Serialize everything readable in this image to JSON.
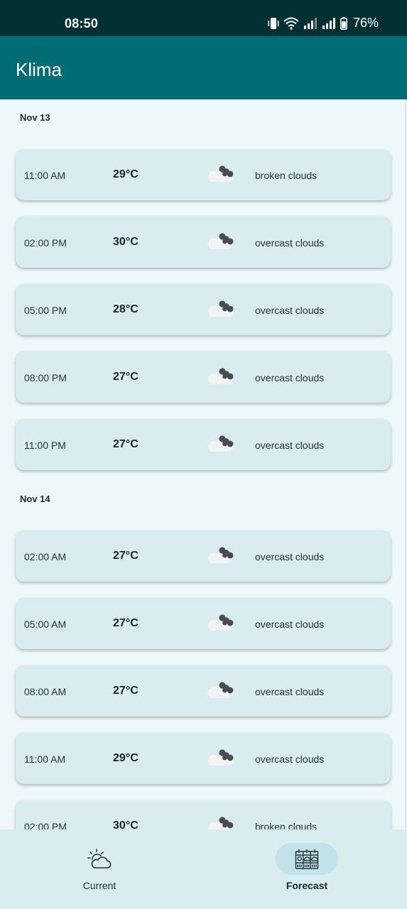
{
  "status_bar": {
    "time": "08:50",
    "battery": "76%"
  },
  "app_bar": {
    "title": "Klima"
  },
  "forecast": [
    {
      "date": "Nov 13",
      "items": [
        {
          "time": "11:00 AM",
          "temp": "29°C",
          "icon": "broken-clouds-icon",
          "desc": "broken clouds"
        },
        {
          "time": "02:00 PM",
          "temp": "30°C",
          "icon": "overcast-clouds-icon",
          "desc": "overcast clouds"
        },
        {
          "time": "05:00 PM",
          "temp": "28°C",
          "icon": "overcast-clouds-icon",
          "desc": "overcast clouds"
        },
        {
          "time": "08:00 PM",
          "temp": "27°C",
          "icon": "overcast-clouds-icon",
          "desc": "overcast clouds"
        },
        {
          "time": "11:00 PM",
          "temp": "27°C",
          "icon": "overcast-clouds-icon",
          "desc": "overcast clouds"
        }
      ]
    },
    {
      "date": "Nov 14",
      "items": [
        {
          "time": "02:00 AM",
          "temp": "27°C",
          "icon": "overcast-clouds-icon",
          "desc": "overcast clouds"
        },
        {
          "time": "05:00 AM",
          "temp": "27°C",
          "icon": "overcast-clouds-icon",
          "desc": "overcast clouds"
        },
        {
          "time": "08:00 AM",
          "temp": "27°C",
          "icon": "overcast-clouds-icon",
          "desc": "overcast clouds"
        },
        {
          "time": "11:00 AM",
          "temp": "29°C",
          "icon": "overcast-clouds-icon",
          "desc": "overcast clouds"
        },
        {
          "time": "02:00 PM",
          "temp": "30°C",
          "icon": "broken-clouds-icon",
          "desc": "broken clouds"
        }
      ]
    }
  ],
  "bottom_nav": {
    "current_label": "Current",
    "forecast_label": "Forecast",
    "selected": "forecast"
  },
  "colors": {
    "status_bar": "#013133",
    "app_bar": "#006d75",
    "background": "#eef8fb",
    "card": "#d9ecf0",
    "nav_pill": "#c2e3ea"
  }
}
